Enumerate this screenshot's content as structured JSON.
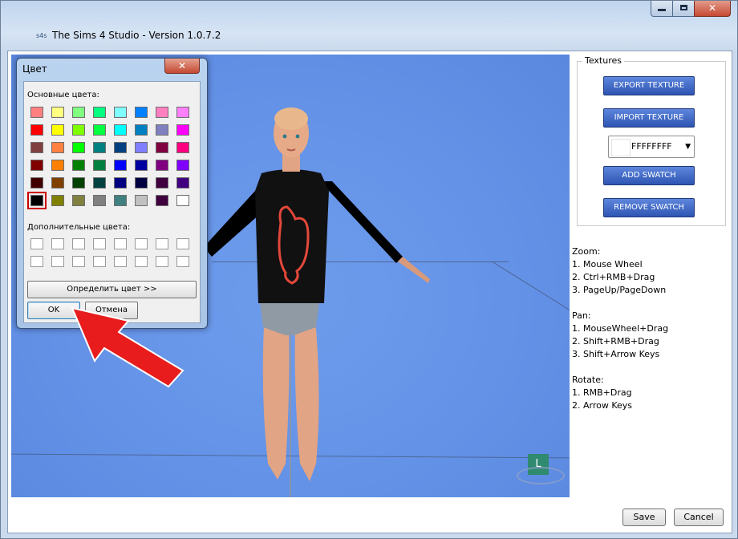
{
  "window": {
    "title": "The Sims 4 Studio - Version 1.0.7.2",
    "app_icon_text": "s4s",
    "minimize": "",
    "maximize": "",
    "close": "✕"
  },
  "textures": {
    "legend": "Textures",
    "export_label": "EXPORT TEXTURE",
    "import_label": "IMPORT TEXTURE",
    "color_value": "FFFFFFFF",
    "add_swatch_label": "ADD SWATCH",
    "remove_swatch_label": "REMOVE SWATCH"
  },
  "help": {
    "zoom_title": "Zoom:",
    "zoom_1": "1. Mouse Wheel",
    "zoom_2": "2. Ctrl+RMB+Drag",
    "zoom_3": "3. PageUp/PageDown",
    "pan_title": "Pan:",
    "pan_1": "1. MouseWheel+Drag",
    "pan_2": "2. Shift+RMB+Drag",
    "pan_3": "3. Shift+Arrow Keys",
    "rotate_title": "Rotate:",
    "rotate_1": "1. RMB+Drag",
    "rotate_2": "2. Arrow Keys"
  },
  "footer": {
    "save_label": "Save",
    "cancel_label": "Cancel"
  },
  "viewport": {
    "axis_label": "L"
  },
  "color_dialog": {
    "title": "Цвет",
    "close": "✕",
    "basic_label": "Основные цвета:",
    "custom_label": "Дополнительные цвета:",
    "define_label": "Определить цвет >>",
    "ok_label": "OK",
    "cancel_label": "Отмена",
    "basic_colors": [
      [
        "#ff8080",
        "#ffff80",
        "#80ff80",
        "#00ff80",
        "#80ffff",
        "#0080ff",
        "#ff80c0",
        "#ff80ff"
      ],
      [
        "#ff0000",
        "#ffff00",
        "#80ff00",
        "#00ff40",
        "#00ffff",
        "#0080c0",
        "#8080c0",
        "#ff00ff"
      ],
      [
        "#804040",
        "#ff8040",
        "#00ff00",
        "#008080",
        "#004080",
        "#8080ff",
        "#800040",
        "#ff0080"
      ],
      [
        "#800000",
        "#ff8000",
        "#008000",
        "#008040",
        "#0000ff",
        "#0000a0",
        "#800080",
        "#8000ff"
      ],
      [
        "#400000",
        "#804000",
        "#004000",
        "#004040",
        "#000080",
        "#000040",
        "#400040",
        "#400080"
      ],
      [
        "#000000",
        "#808000",
        "#808040",
        "#808080",
        "#408080",
        "#c0c0c0",
        "#400040",
        "#ffffff"
      ]
    ],
    "selected_color": "#000000"
  }
}
